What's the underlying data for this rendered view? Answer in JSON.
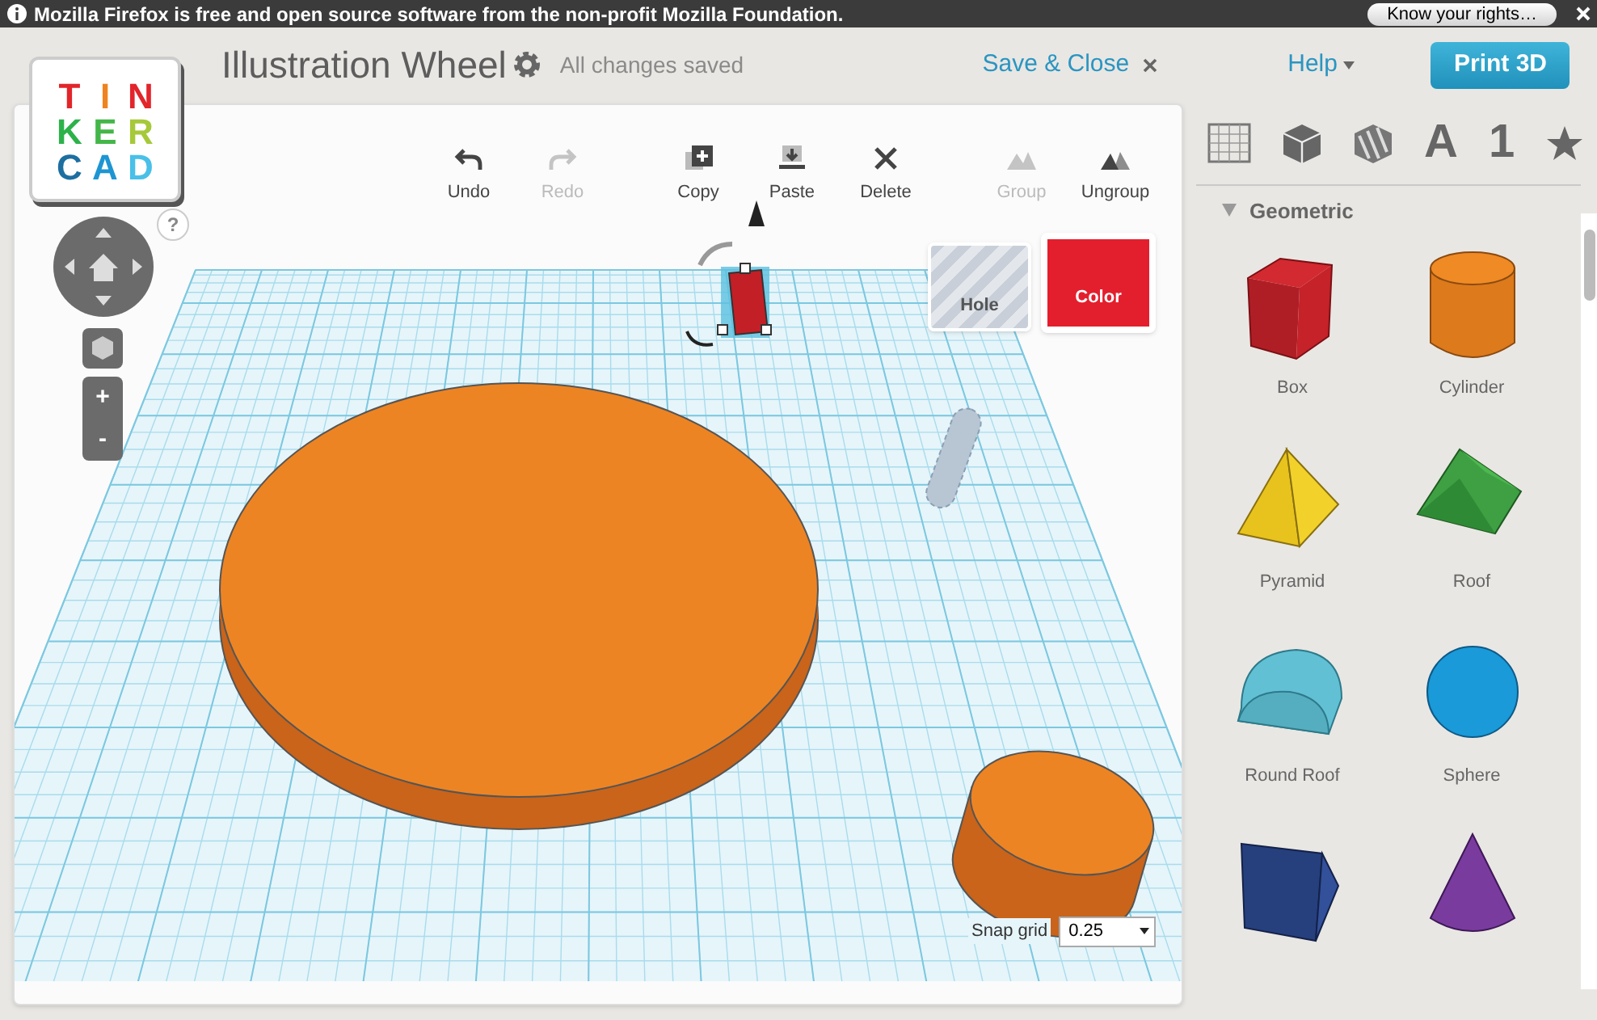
{
  "notification": {
    "text": "Mozilla Firefox is free and open source software from the non-profit Mozilla Foundation.",
    "button": "Know your rights…"
  },
  "logo": {
    "letters": [
      {
        "char": "T",
        "color": "#e2252b"
      },
      {
        "char": "I",
        "color": "#f0831f"
      },
      {
        "char": "N",
        "color": "#e2252b"
      },
      {
        "char": "K",
        "color": "#2db24a"
      },
      {
        "char": "E",
        "color": "#44b649"
      },
      {
        "char": "R",
        "color": "#a6c93a"
      },
      {
        "char": "C",
        "color": "#1d6fa0"
      },
      {
        "char": "A",
        "color": "#1e95d3"
      },
      {
        "char": "D",
        "color": "#49c0e8"
      }
    ]
  },
  "header": {
    "title": "Illustration Wheel",
    "status": "All changes saved",
    "save_close": "Save & Close",
    "help": "Help",
    "print": "Print 3D"
  },
  "toolbar": [
    {
      "kind": "undo",
      "label": "Undo",
      "disabled": false
    },
    {
      "kind": "redo",
      "label": "Redo",
      "disabled": true
    },
    {
      "kind": "copy",
      "label": "Copy",
      "disabled": false
    },
    {
      "kind": "paste",
      "label": "Paste",
      "disabled": false
    },
    {
      "kind": "delete",
      "label": "Delete",
      "disabled": false
    },
    {
      "kind": "group",
      "label": "Group",
      "disabled": true
    },
    {
      "kind": "ungroup",
      "label": "Ungroup",
      "disabled": false
    }
  ],
  "help_button": "?",
  "zoom": [
    "+",
    "-"
  ],
  "swatches": [
    {
      "kind": "hole",
      "label": "Hole"
    },
    {
      "kind": "color",
      "label": "Color",
      "color": "#e41f2d"
    }
  ],
  "snap_grid": {
    "label": "Snap grid",
    "value": "0.25"
  },
  "library_tabs": [
    {
      "kind": "grid"
    },
    {
      "kind": "box"
    },
    {
      "kind": "hole"
    },
    {
      "kind": "text",
      "text": "A"
    },
    {
      "kind": "text",
      "text": "1"
    },
    {
      "kind": "star"
    }
  ],
  "section": {
    "title": "Geometric",
    "expanded": true
  },
  "shapes": [
    {
      "kind": "box",
      "label": "Box"
    },
    {
      "kind": "cylinder",
      "label": "Cylinder"
    },
    {
      "kind": "pyramid",
      "label": "Pyramid"
    },
    {
      "kind": "roof",
      "label": "Roof"
    },
    {
      "kind": "roundroof",
      "label": "Round Roof"
    },
    {
      "kind": "sphere",
      "label": "Sphere"
    },
    {
      "kind": "wedge"
    },
    {
      "kind": "cone"
    }
  ]
}
